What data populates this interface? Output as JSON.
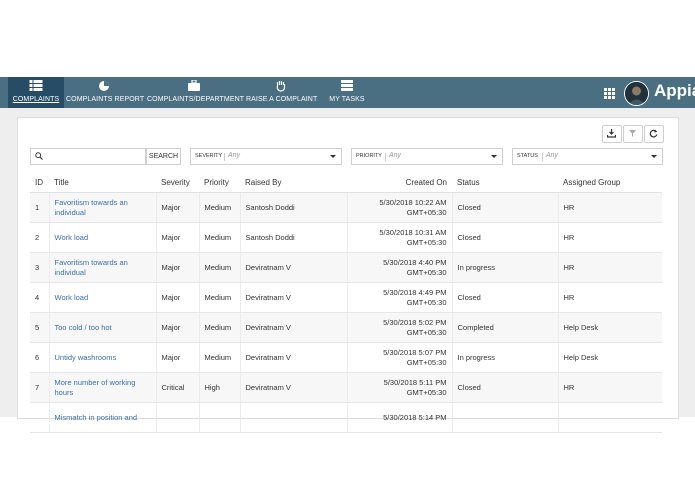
{
  "nav": {
    "tabs": [
      {
        "label": "COMPLAINTS",
        "icon": "grid-list-icon"
      },
      {
        "label": "COMPLAINTS REPORT",
        "icon": "pie-chart-icon"
      },
      {
        "label": "COMPLAINTS/DEPARTMENT",
        "icon": "briefcase-icon"
      },
      {
        "label": "RAISE A COMPLAINT",
        "icon": "hand-icon"
      },
      {
        "label": "MY TASKS",
        "icon": "stack-icon"
      }
    ],
    "logo": "Appian"
  },
  "search": {
    "placeholder": "",
    "button_label": "SEARCH"
  },
  "filters": [
    {
      "label": "SEVERITY",
      "value": "Any"
    },
    {
      "label": "PRIORITY",
      "value": "Any"
    },
    {
      "label": "STATUS",
      "value": "Any"
    }
  ],
  "table": {
    "columns": [
      "ID",
      "Title",
      "Severity",
      "Priority",
      "Raised By",
      "Created On",
      "Status",
      "Assigned Group"
    ],
    "rows": [
      {
        "id": "1",
        "title_l1": "Favoritism towards an",
        "title_l2": "individual",
        "severity": "Major",
        "priority": "Medium",
        "raised_by": "Santosh Doddi",
        "created_l1": "5/30/2018 10:22 AM",
        "created_l2": "GMT+05:30",
        "status": "Closed",
        "group": "HR"
      },
      {
        "id": "2",
        "title_l1": "Work load",
        "title_l2": "",
        "severity": "Major",
        "priority": "Medium",
        "raised_by": "Santosh Doddi",
        "created_l1": "5/30/2018 10:31 AM",
        "created_l2": "GMT+05:30",
        "status": "Closed",
        "group": "HR"
      },
      {
        "id": "3",
        "title_l1": "Favoritism towards an",
        "title_l2": "individual",
        "severity": "Major",
        "priority": "Medium",
        "raised_by": "Deviratnam V",
        "created_l1": "5/30/2018 4:40 PM",
        "created_l2": "GMT+05:30",
        "status": "In progress",
        "group": "HR"
      },
      {
        "id": "4",
        "title_l1": "Work load",
        "title_l2": "",
        "severity": "Major",
        "priority": "Medium",
        "raised_by": "Deviratnam V",
        "created_l1": "5/30/2018 4:49 PM",
        "created_l2": "GMT+05:30",
        "status": "Closed",
        "group": "HR"
      },
      {
        "id": "5",
        "title_l1": "Too cold / too hot",
        "title_l2": "",
        "severity": "Major",
        "priority": "Medium",
        "raised_by": "Deviratnam V",
        "created_l1": "5/30/2018 5:02 PM",
        "created_l2": "GMT+05:30",
        "status": "Completed",
        "group": "Help Desk"
      },
      {
        "id": "6",
        "title_l1": "Untidy washrooms",
        "title_l2": "",
        "severity": "Major",
        "priority": "Medium",
        "raised_by": "Deviratnam V",
        "created_l1": "5/30/2018 5:07 PM",
        "created_l2": "GMT+05:30",
        "status": "In progress",
        "group": "Help Desk"
      },
      {
        "id": "7",
        "title_l1": "More number of working",
        "title_l2": "hours",
        "severity": "Critical",
        "priority": "High",
        "raised_by": "Deviratnam V",
        "created_l1": "5/30/2018 5:11 PM",
        "created_l2": "GMT+05:30",
        "status": "Closed",
        "group": "HR"
      },
      {
        "id": "",
        "title_l1": "Mismatch in position and",
        "title_l2": "",
        "severity": "",
        "priority": "",
        "raised_by": "",
        "created_l1": "5/30/2018 5:14 PM",
        "created_l2": "",
        "status": "",
        "group": ""
      }
    ]
  }
}
